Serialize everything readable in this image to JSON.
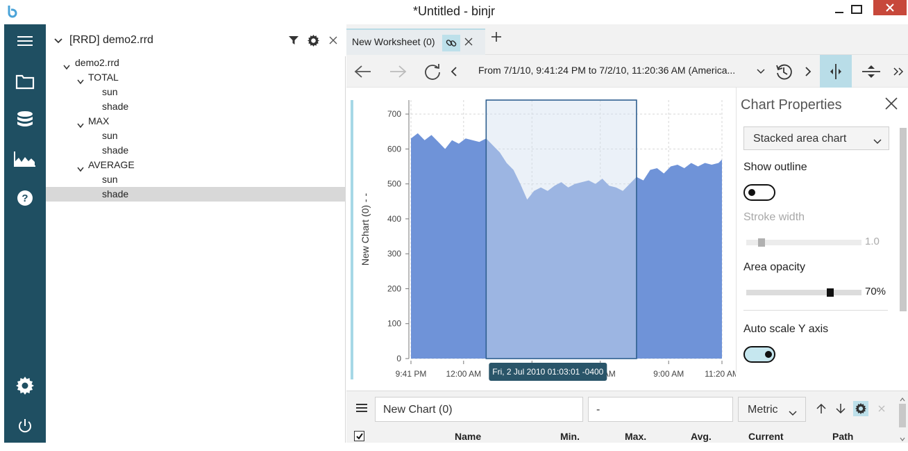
{
  "window": {
    "title": "*Untitled - binjr"
  },
  "tree": {
    "title": "[RRD] demo2.rrd",
    "root": "demo2.rrd",
    "nodes": [
      {
        "label": "TOTAL",
        "level": 1,
        "children": [
          "sun",
          "shade"
        ]
      },
      {
        "label": "MAX",
        "level": 1,
        "children": [
          "sun",
          "shade"
        ]
      },
      {
        "label": "AVERAGE",
        "level": 1,
        "children": [
          "sun",
          "shade"
        ]
      }
    ],
    "selected": "AVERAGE/shade"
  },
  "worksheet": {
    "tab_label": "New Worksheet (0)",
    "range_text": "From 7/1/10, 9:41:24 PM to 7/2/10, 11:20:36 AM (America...",
    "chart_data": {
      "type": "area",
      "ylabel": "New Chart (0) - -",
      "ylim": [
        0,
        740
      ],
      "yticks": [
        "700",
        "600",
        "500",
        "400",
        "300",
        "200",
        "100",
        "0"
      ],
      "ytick_values": [
        700,
        600,
        500,
        400,
        300,
        200,
        100,
        0
      ],
      "xticks": [
        "9:41 PM",
        "12:00 AM",
        "3:00 AM",
        "6:00 AM",
        "9:00 AM",
        "11:20 AM"
      ],
      "xtick_hours": [
        0,
        2.31,
        5.31,
        8.31,
        11.31,
        13.65
      ],
      "x_hours": [
        0,
        0.3,
        0.6,
        0.9,
        1.2,
        1.5,
        1.8,
        2.1,
        2.4,
        2.7,
        3.0,
        3.3,
        3.6,
        3.9,
        4.2,
        4.5,
        4.8,
        5.1,
        5.4,
        5.7,
        6.0,
        6.3,
        6.6,
        6.9,
        7.2,
        7.5,
        7.8,
        8.1,
        8.4,
        8.7,
        9.0,
        9.3,
        9.6,
        9.9,
        10.2,
        10.5,
        10.8,
        11.1,
        11.4,
        11.7,
        12.0,
        12.3,
        12.6,
        12.9,
        13.2,
        13.5,
        13.65
      ],
      "values": [
        630,
        645,
        625,
        640,
        620,
        600,
        625,
        615,
        630,
        625,
        620,
        630,
        610,
        590,
        560,
        540,
        500,
        455,
        480,
        490,
        480,
        495,
        505,
        490,
        500,
        505,
        510,
        500,
        515,
        495,
        490,
        480,
        500,
        520,
        510,
        540,
        545,
        530,
        550,
        555,
        545,
        560,
        550,
        560,
        555,
        560,
        570
      ],
      "series": [
        {
          "name": "shade",
          "color": "#6f93d8"
        }
      ],
      "selection": {
        "start_hour": 3.3,
        "end_hour": 9.9
      },
      "tooltip": "Fri, 2 Jul 2010 01:03:01 -0400"
    }
  },
  "properties": {
    "title": "Chart Properties",
    "chart_type": "Stacked area chart",
    "show_outline_label": "Show outline",
    "show_outline": false,
    "stroke_width_label": "Stroke width",
    "stroke_width_value": "1.0",
    "stroke_width_fraction": 0.1,
    "area_opacity_label": "Area opacity",
    "area_opacity_value": "70%",
    "area_opacity_fraction": 0.7,
    "autoscale_label": "Auto scale Y axis",
    "autoscale": true
  },
  "bottom": {
    "chart_name": "New Chart (0)",
    "unit": "-",
    "prefix": "Metric",
    "columns": [
      "Name",
      "Min.",
      "Max.",
      "Avg.",
      "Current",
      "Path"
    ]
  },
  "colors": {
    "rail": "#1f4f62",
    "accent": "#b9dde8",
    "area": "#6f93d8"
  }
}
